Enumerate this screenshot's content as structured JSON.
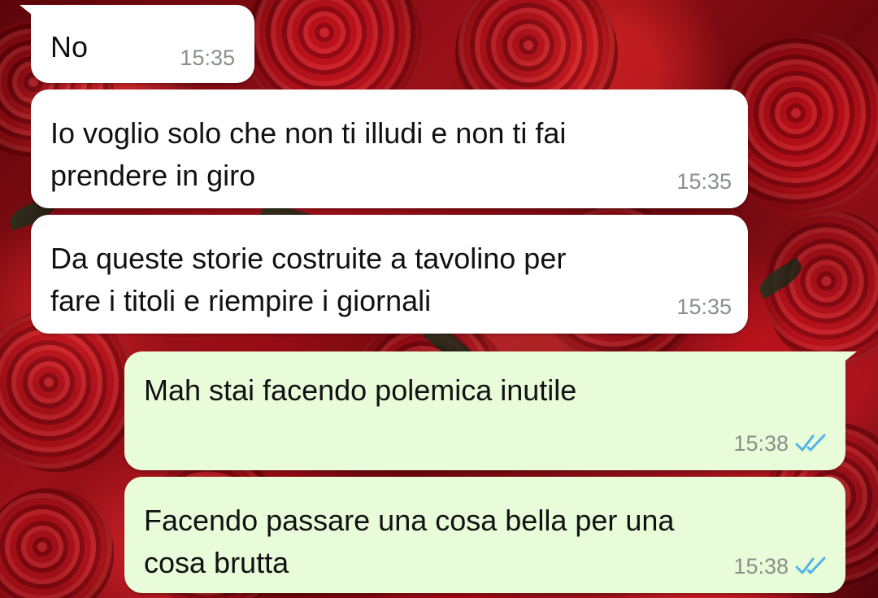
{
  "messages": [
    {
      "direction": "incoming",
      "text": "No",
      "time": "15:35"
    },
    {
      "direction": "incoming",
      "text": "Io voglio solo che non ti illudi e non ti fai\nprendere in giro",
      "time": "15:35"
    },
    {
      "direction": "incoming",
      "text": "Da queste storie costruite a tavolino per\nfare i titoli e riempire i giornali",
      "time": "15:35"
    },
    {
      "direction": "outgoing",
      "text": "Mah stai facendo polemica inutile",
      "time": "15:38",
      "status_icon": "double-check-read-icon"
    },
    {
      "direction": "outgoing",
      "text": "Facendo passare una cosa bella per una\ncosa brutta",
      "time": "15:38",
      "status_icon": "double-check-read-icon"
    }
  ],
  "colors": {
    "incoming_bubble": "#ffffff",
    "outgoing_bubble": "#e8fcd9",
    "timestamp": "#8a8f8a",
    "read_tick": "#4fb3e8",
    "wallpaper_theme": "red roses"
  }
}
